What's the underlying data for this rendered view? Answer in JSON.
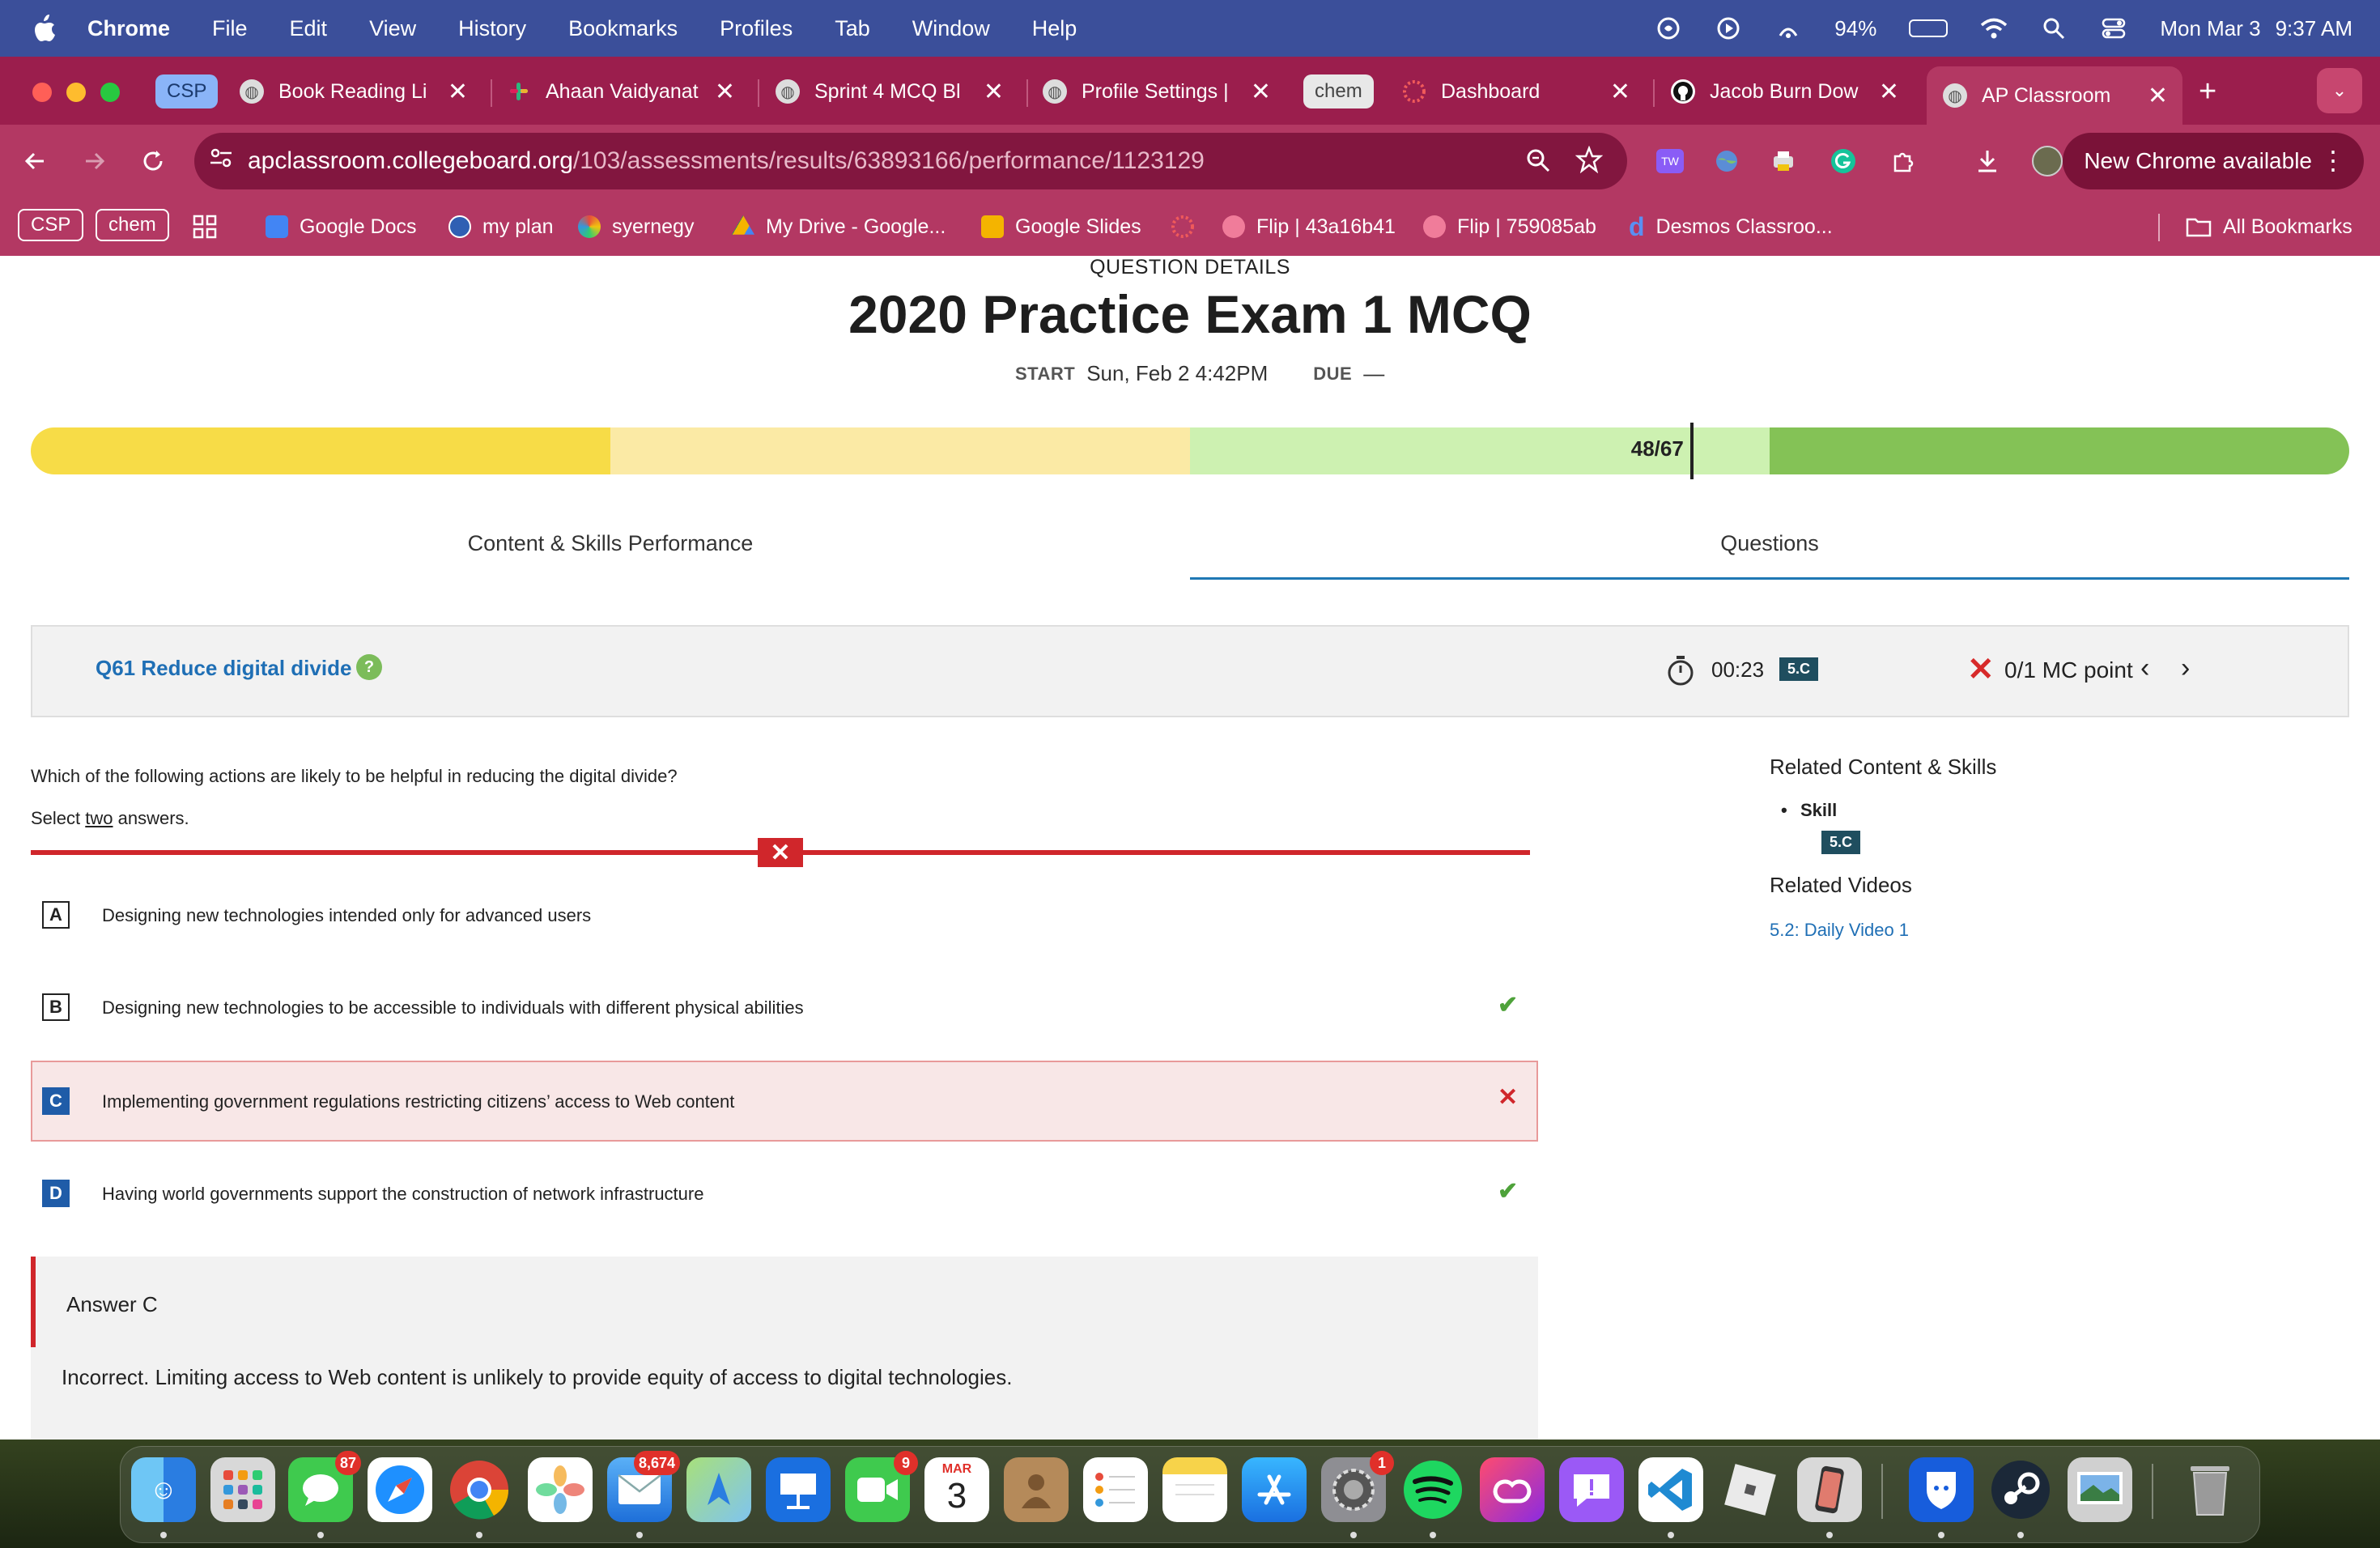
{
  "menubar": {
    "app": "Chrome",
    "items": [
      "File",
      "Edit",
      "View",
      "History",
      "Bookmarks",
      "Profiles",
      "Tab",
      "Window",
      "Help"
    ],
    "battery": "94%",
    "date": "Mon Mar 3",
    "time": "9:37 AM"
  },
  "tabs": {
    "group_csp": "CSP",
    "group_chem": "chem",
    "items": [
      {
        "label": "Book Reading Li"
      },
      {
        "label": "Ahaan Vaidyanat"
      },
      {
        "label": "Sprint 4 MCQ Bl"
      },
      {
        "label": "Profile Settings |"
      },
      {
        "label": "Dashboard"
      },
      {
        "label": "Jacob Burn Dow"
      },
      {
        "label": "AP Classroom"
      }
    ],
    "new_tab": "+",
    "close_glyph": "✕"
  },
  "omnibox": {
    "host": "apclassroom.collegeboard.org",
    "path": "/103/assessments/results/63893166/performance/1123129"
  },
  "new_chrome": "New Chrome available",
  "bookmarks": {
    "chip_csp": "CSP",
    "chip_chem": "chem",
    "items": [
      "Google Docs",
      "my plan",
      "syernegy",
      "My Drive - Google...",
      "Google Slides",
      "Flip | 43a16b41",
      "Flip | 759085ab",
      "Desmos Classroo..."
    ],
    "all": "All Bookmarks"
  },
  "page": {
    "section_label": "QUESTION DETAILS",
    "title": "2020 Practice Exam 1 MCQ",
    "start_label": "START",
    "start_value": "Sun, Feb 2 4:42PM",
    "due_label": "DUE",
    "due_value": "—",
    "score": "48/67",
    "score_fraction": 0.7164,
    "progress_colors": [
      "#f7dc47",
      "#fbeaa5",
      "#cdf1b1",
      "#84c256"
    ],
    "tabs": [
      "Content & Skills Performance",
      "Questions"
    ],
    "question_header": {
      "title": "Q61 Reduce digital divide",
      "help": "?",
      "time": "00:23",
      "skill": "5.C",
      "score": "0/1 MC point",
      "prev": "‹",
      "next": "›"
    },
    "question_text": "Which of the following actions are likely to be helpful in reducing the digital divide?",
    "select_prefix": "Select ",
    "select_word": "two",
    "select_suffix": " answers.",
    "wrong_glyph": "✕",
    "correct_glyph": "✔",
    "options": [
      {
        "letter": "A",
        "text": "Designing new technologies intended only for advanced users"
      },
      {
        "letter": "B",
        "text": "Designing new technologies to be accessible to individuals with different physical abilities"
      },
      {
        "letter": "C",
        "text": "Implementing government regulations restricting citizens’ access to Web content"
      },
      {
        "letter": "D",
        "text": "Having world governments support the construction of network infrastructure"
      }
    ],
    "answer_title": "Answer C",
    "answer_text": "Incorrect. Limiting access to Web content is unlikely to provide equity of access to digital technologies.",
    "related": {
      "heading": "Related Content & Skills",
      "skill_label": "Skill",
      "skill_badge": "5.C",
      "videos_heading": "Related Videos",
      "video_link": "5.2: Daily Video 1"
    }
  },
  "dock": {
    "messages_badge": "87",
    "mail_badge": "8,674",
    "facetime_badge": "9",
    "calendar_month": "MAR",
    "calendar_day": "3",
    "settings_badge": "1"
  }
}
